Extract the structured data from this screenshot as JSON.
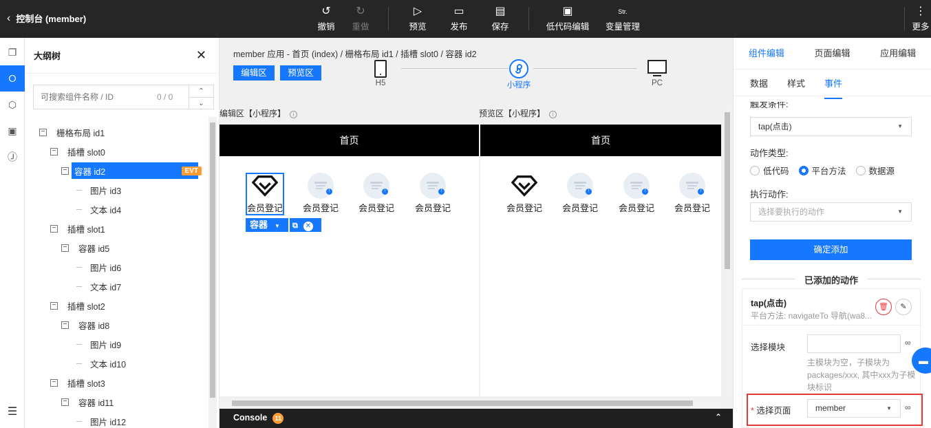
{
  "header": {
    "back_label": "控制台 (member)",
    "tools": [
      {
        "label": "撤销",
        "icon": "undo-icon",
        "glyph": "↺"
      },
      {
        "label": "重做",
        "icon": "redo-icon",
        "glyph": "↻"
      },
      {
        "label": "预览",
        "icon": "play-icon",
        "glyph": "▷"
      },
      {
        "label": "发布",
        "icon": "publish-icon",
        "glyph": "▭"
      },
      {
        "label": "保存",
        "icon": "save-icon",
        "glyph": "▤"
      },
      {
        "label": "低代码编辑",
        "icon": "code-edit-icon",
        "glyph": "▣"
      },
      {
        "label": "变量管理",
        "icon": "variable-icon",
        "glyph": "Str."
      },
      {
        "label": "更多",
        "icon": "more-icon",
        "glyph": "⋮"
      }
    ]
  },
  "outline": {
    "title": "大纲树",
    "search_placeholder": "可搜索组件名称 / ID",
    "search_count": "0 / 0",
    "nodes": [
      {
        "label": "栅格布局 id1",
        "level": 0,
        "toggle": "−"
      },
      {
        "label": "插槽 slot0",
        "level": 1,
        "toggle": "−"
      },
      {
        "label": "容器 id2",
        "level": 2,
        "toggle": "−",
        "selected": true,
        "badge": "EVT"
      },
      {
        "label": "图片 id3",
        "level": 3
      },
      {
        "label": "文本 id4",
        "level": 3
      },
      {
        "label": "插槽 slot1",
        "level": 1,
        "toggle": "−"
      },
      {
        "label": "容器 id5",
        "level": 2,
        "toggle": "−"
      },
      {
        "label": "图片 id6",
        "level": 3
      },
      {
        "label": "文本 id7",
        "level": 3
      },
      {
        "label": "插槽 slot2",
        "level": 1,
        "toggle": "−"
      },
      {
        "label": "容器 id8",
        "level": 2,
        "toggle": "−"
      },
      {
        "label": "图片 id9",
        "level": 3
      },
      {
        "label": "文本 id10",
        "level": 3
      },
      {
        "label": "插槽 slot3",
        "level": 1,
        "toggle": "−"
      },
      {
        "label": "容器 id11",
        "level": 2,
        "toggle": "−"
      },
      {
        "label": "图片 id12",
        "level": 3
      }
    ]
  },
  "canvas": {
    "breadcrumb": "member 应用 - 首页 (index)  /  栅格布局 id1  /  插槽 slot0  /  容器 id2",
    "edit_btn": "编辑区",
    "preview_btn": "预览区",
    "steps": [
      "H5",
      "小程序",
      "PC"
    ],
    "edit_label": "编辑区【小程序】",
    "preview_label": "预览区【小程序】",
    "page_title": "首页",
    "item_label": "会员登记",
    "container_label": "容器",
    "console_label": "Console",
    "console_count": "11"
  },
  "props": {
    "tabs": [
      "组件编辑",
      "页面编辑",
      "应用编辑"
    ],
    "subtabs": [
      "数据",
      "样式",
      "事件"
    ],
    "trigger_label": "触发条件:",
    "trigger_value": "tap(点击)",
    "action_type_label": "动作类型:",
    "action_types": [
      "低代码",
      "平台方法",
      "数据源"
    ],
    "exec_label": "执行动作:",
    "exec_placeholder": "选择要执行的动作",
    "confirm_btn": "确定添加",
    "added_title": "已添加的动作",
    "action_name": "tap(点击)",
    "action_desc": "平台方法: navigateTo 导航(wa8...",
    "module_label": "选择模块",
    "module_hint": "主模块为空，子模块为packages/xxx, 其中xxx为子模块标识",
    "page_label": "选择页面",
    "page_value": "member"
  }
}
